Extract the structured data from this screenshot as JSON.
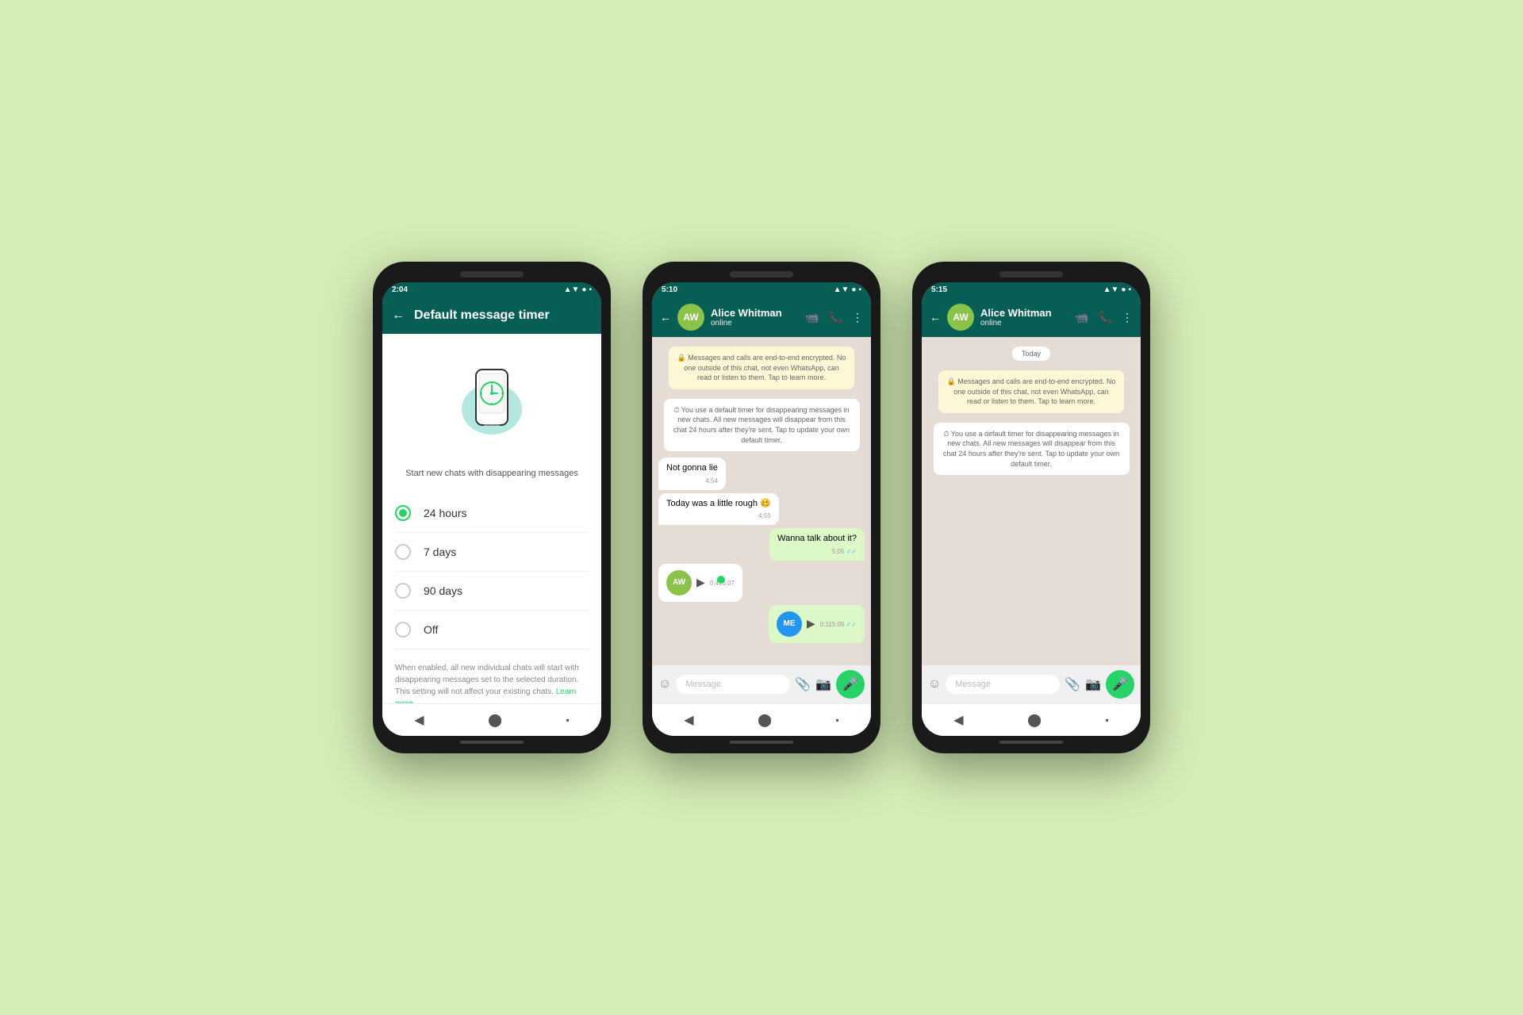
{
  "background": "#d4edb5",
  "phone1": {
    "status_bar": {
      "time": "2:04",
      "signal": "▲▼",
      "wifi": "●",
      "battery": "▪"
    },
    "header": {
      "back_icon": "←",
      "title": "Default message timer"
    },
    "illustration_alt": "Phone with timer icon",
    "subtitle": "Start new chats with disappearing messages",
    "options": [
      {
        "label": "24 hours",
        "selected": true
      },
      {
        "label": "7 days",
        "selected": false
      },
      {
        "label": "90 days",
        "selected": false
      },
      {
        "label": "Off",
        "selected": false
      }
    ],
    "description": "When enabled, all new individual chats will start with disappearing messages set to the selected duration. This setting will not affect your existing chats.",
    "learn_more": "Learn more",
    "nav": {
      "back": "◀",
      "home": "⬤",
      "square": "▪"
    }
  },
  "phone2": {
    "status_bar": {
      "time": "5:10"
    },
    "header": {
      "back_icon": "←",
      "name": "Alice Whitman",
      "status": "online",
      "video_icon": "▶",
      "call_icon": "📞",
      "more_icon": "⋮"
    },
    "messages": [
      {
        "type": "encryption",
        "text": "🔒 Messages and calls are end-to-end encrypted. No one outside of this chat, not even WhatsApp, can read or listen to them. Tap to learn more."
      },
      {
        "type": "timer_notice",
        "text": "⏱ You use a default timer for disappearing messages in new chats. All new messages will disappear from this chat 24 hours after they're sent. Tap to update your own default timer."
      },
      {
        "type": "incoming",
        "text": "Not gonna lie",
        "time": "4:54"
      },
      {
        "type": "incoming",
        "text": "Today was a little rough 🥴",
        "time": "4:55"
      },
      {
        "type": "outgoing",
        "text": "Wanna talk about it?",
        "time": "5:05",
        "checks": "✓✓"
      },
      {
        "type": "voice_incoming",
        "duration": "0:43",
        "time": "5:07",
        "progress": 30
      },
      {
        "type": "voice_outgoing",
        "duration": "0:11",
        "time": "5:09",
        "checks": "✓✓",
        "progress": 0
      }
    ],
    "input": {
      "placeholder": "Message",
      "emoji_icon": "☺",
      "attach_icon": "📎",
      "camera_icon": "📷",
      "mic_icon": "🎤"
    },
    "nav": {
      "back": "◀",
      "home": "⬤",
      "square": "▪"
    }
  },
  "phone3": {
    "status_bar": {
      "time": "5:15"
    },
    "header": {
      "back_icon": "←",
      "name": "Alice Whitman",
      "status": "online",
      "video_icon": "▶",
      "call_icon": "📞",
      "more_icon": "⋮"
    },
    "today_badge": "Today",
    "messages": [
      {
        "type": "encryption",
        "text": "🔒 Messages and calls are end-to-end encrypted. No one outside of this chat, not even WhatsApp, can read or listen to them. Tap to learn more."
      },
      {
        "type": "timer_notice",
        "text": "⏱ You use a default timer for disappearing messages in new chats. All new messages will disappear from this chat 24 hours after they're sent. Tap to update your own default timer."
      }
    ],
    "input": {
      "placeholder": "Message",
      "emoji_icon": "☺",
      "attach_icon": "📎",
      "camera_icon": "📷",
      "mic_icon": "🎤"
    },
    "nav": {
      "back": "◀",
      "home": "⬤",
      "square": "▪"
    }
  }
}
